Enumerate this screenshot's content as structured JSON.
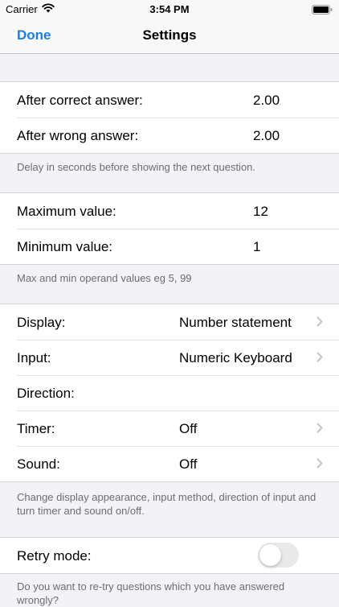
{
  "status_bar": {
    "carrier": "Carrier",
    "time": "3:54 PM"
  },
  "nav": {
    "done_label": "Done",
    "title": "Settings"
  },
  "colors": {
    "accent": "#1e7ee0",
    "background": "#f2f2f7"
  },
  "delay_section": {
    "rows": [
      {
        "label": "After correct answer:",
        "value": "2.00"
      },
      {
        "label": "After wrong answer:",
        "value": "2.00"
      }
    ],
    "footer": "Delay in seconds before showing the next question."
  },
  "range_section": {
    "rows": [
      {
        "label": "Maximum value:",
        "value": "12"
      },
      {
        "label": "Minimum value:",
        "value": "1"
      }
    ],
    "footer": "Max and min operand values eg 5, 99"
  },
  "display_section": {
    "rows": [
      {
        "label": "Display:",
        "value": "Number statement"
      },
      {
        "label": "Input:",
        "value": "Numeric Keyboard"
      },
      {
        "label": "Direction:",
        "value": ""
      },
      {
        "label": "Timer:",
        "value": "Off"
      },
      {
        "label": "Sound:",
        "value": "Off"
      }
    ],
    "footer": "Change display appearance, input method, direction of input and turn timer and sound on/off."
  },
  "retry_section": {
    "label": "Retry mode:",
    "toggle_on": false,
    "footer": "Do you want to re-try questions which you have answered wrongly?"
  }
}
